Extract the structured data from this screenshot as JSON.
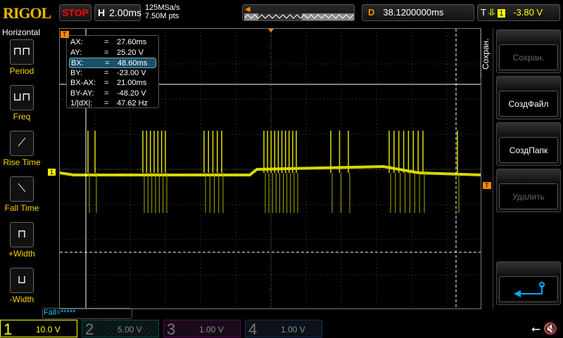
{
  "header": {
    "logo": "RIGOL",
    "run_state": "STOP",
    "horizontal_label": "H",
    "timebase": "2.00ms",
    "sample_rate": "125MSa/s",
    "memory_depth": "7.50M pts",
    "delay_label": "D",
    "delay": "38.1200000ms",
    "trigger_label": "T",
    "trigger_source": "1",
    "trigger_level": "-3.80 V"
  },
  "sidebar": {
    "title": "Horizontal",
    "items": [
      {
        "label": "Period"
      },
      {
        "label": "Freq"
      },
      {
        "label": "Rise Time"
      },
      {
        "label": "Fall Time"
      },
      {
        "label": "+Width"
      },
      {
        "label": "-Width"
      }
    ]
  },
  "cursors": {
    "rows": [
      {
        "name": "AX:",
        "eq": "=",
        "value": "27.60ms"
      },
      {
        "name": "AY:",
        "eq": "=",
        "value": "25.20 V"
      },
      {
        "name": "BX:",
        "eq": "=",
        "value": "48.60ms"
      },
      {
        "name": "BY:",
        "eq": "=",
        "value": "-23.00 V"
      },
      {
        "name": "BX-AX:",
        "eq": "=",
        "value": "21.00ms"
      },
      {
        "name": "BY-AY:",
        "eq": "=",
        "value": "-48.20 V"
      },
      {
        "name": "1/|dX|:",
        "eq": "=",
        "value": "47.62 Hz"
      }
    ]
  },
  "menu": {
    "title": "Сохран.",
    "buttons": [
      {
        "label": "Сохран."
      },
      {
        "label": "СоздФайл"
      },
      {
        "label": "СоздПапк"
      },
      {
        "label": "Удалить"
      }
    ]
  },
  "status": {
    "fall": "Fall=*****"
  },
  "channels": [
    {
      "num": "1",
      "scale": "10.0 V",
      "color": "#ffff00"
    },
    {
      "num": "2",
      "scale": "5.00 V",
      "color": "#00a0a0"
    },
    {
      "num": "3",
      "scale": "1.00 V",
      "color": "#c000c0"
    },
    {
      "num": "4",
      "scale": "1.00 V",
      "color": "#2060c0"
    }
  ],
  "markers": {
    "ch1": "1",
    "trigger": "T"
  }
}
